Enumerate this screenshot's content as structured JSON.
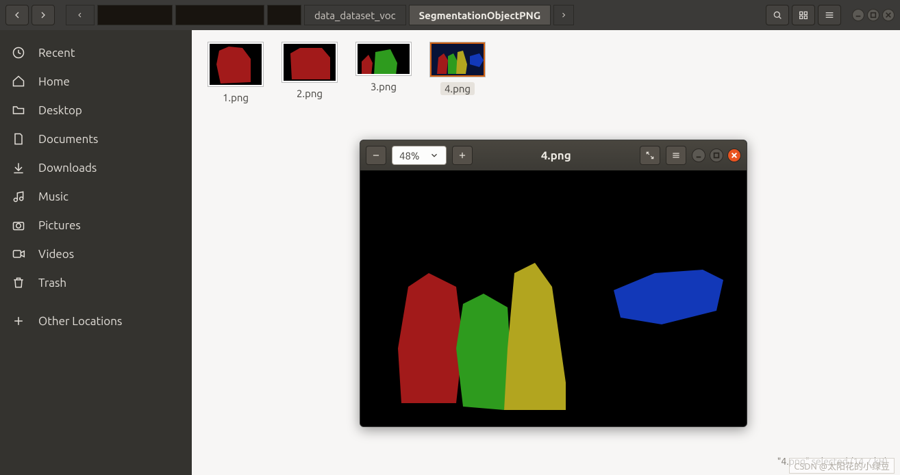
{
  "toolbar": {
    "breadcrumbs": [
      "",
      "data_dataset_voc",
      "SegmentationObjectPNG"
    ],
    "active_breadcrumb_index": 2
  },
  "sidebar": {
    "items": [
      {
        "icon": "clock",
        "label": "Recent"
      },
      {
        "icon": "home",
        "label": "Home"
      },
      {
        "icon": "folder",
        "label": "Desktop"
      },
      {
        "icon": "document",
        "label": "Documents"
      },
      {
        "icon": "download",
        "label": "Downloads"
      },
      {
        "icon": "music",
        "label": "Music"
      },
      {
        "icon": "camera",
        "label": "Pictures"
      },
      {
        "icon": "video",
        "label": "Videos"
      },
      {
        "icon": "trash",
        "label": "Trash"
      },
      {
        "icon": "plus",
        "label": "Other Locations"
      }
    ]
  },
  "files": [
    {
      "name": "1.png",
      "selected": false
    },
    {
      "name": "2.png",
      "selected": false
    },
    {
      "name": "3.png",
      "selected": false
    },
    {
      "name": "4.png",
      "selected": true
    }
  ],
  "viewer": {
    "title": "4.png",
    "zoom_label": "48%"
  },
  "status_bar": "\"4.png\" selected (14.7 kB)",
  "watermark": "CSDN @太阳花的小绿豆"
}
